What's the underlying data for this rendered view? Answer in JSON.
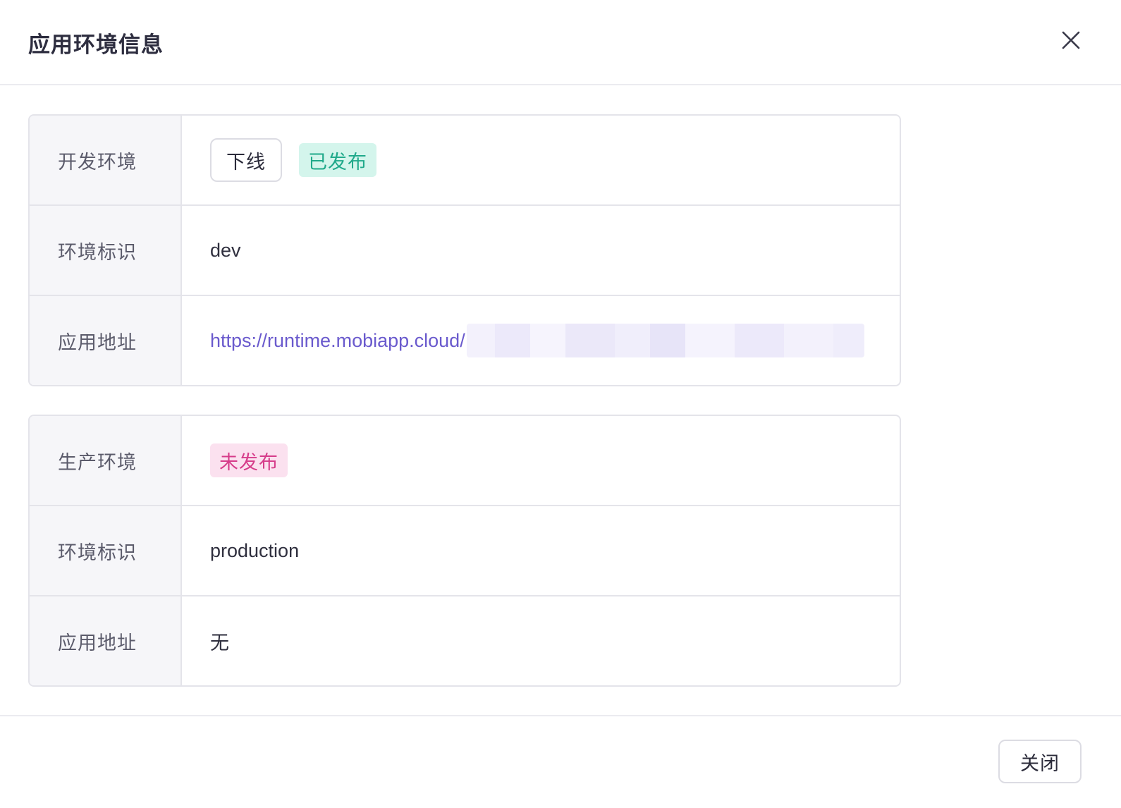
{
  "dialog": {
    "title": "应用环境信息",
    "close_icon": "close-icon"
  },
  "dev_env": {
    "label": "开发环境",
    "offline_button": "下线",
    "status": "已发布",
    "status_color": "#1fa98a",
    "id_label": "环境标识",
    "id_value": "dev",
    "url_label": "应用地址",
    "url_value": "https://runtime.mobiapp.cloud/"
  },
  "prod_env": {
    "label": "生产环境",
    "status": "未发布",
    "status_color": "#d63c8a",
    "id_label": "环境标识",
    "id_value": "production",
    "url_label": "应用地址",
    "url_value": "无"
  },
  "footer": {
    "close_button": "关闭"
  },
  "colors": {
    "link": "#6a5acd",
    "published_bg": "#d4f5ec",
    "unpublished_bg": "#fbe1ef"
  }
}
